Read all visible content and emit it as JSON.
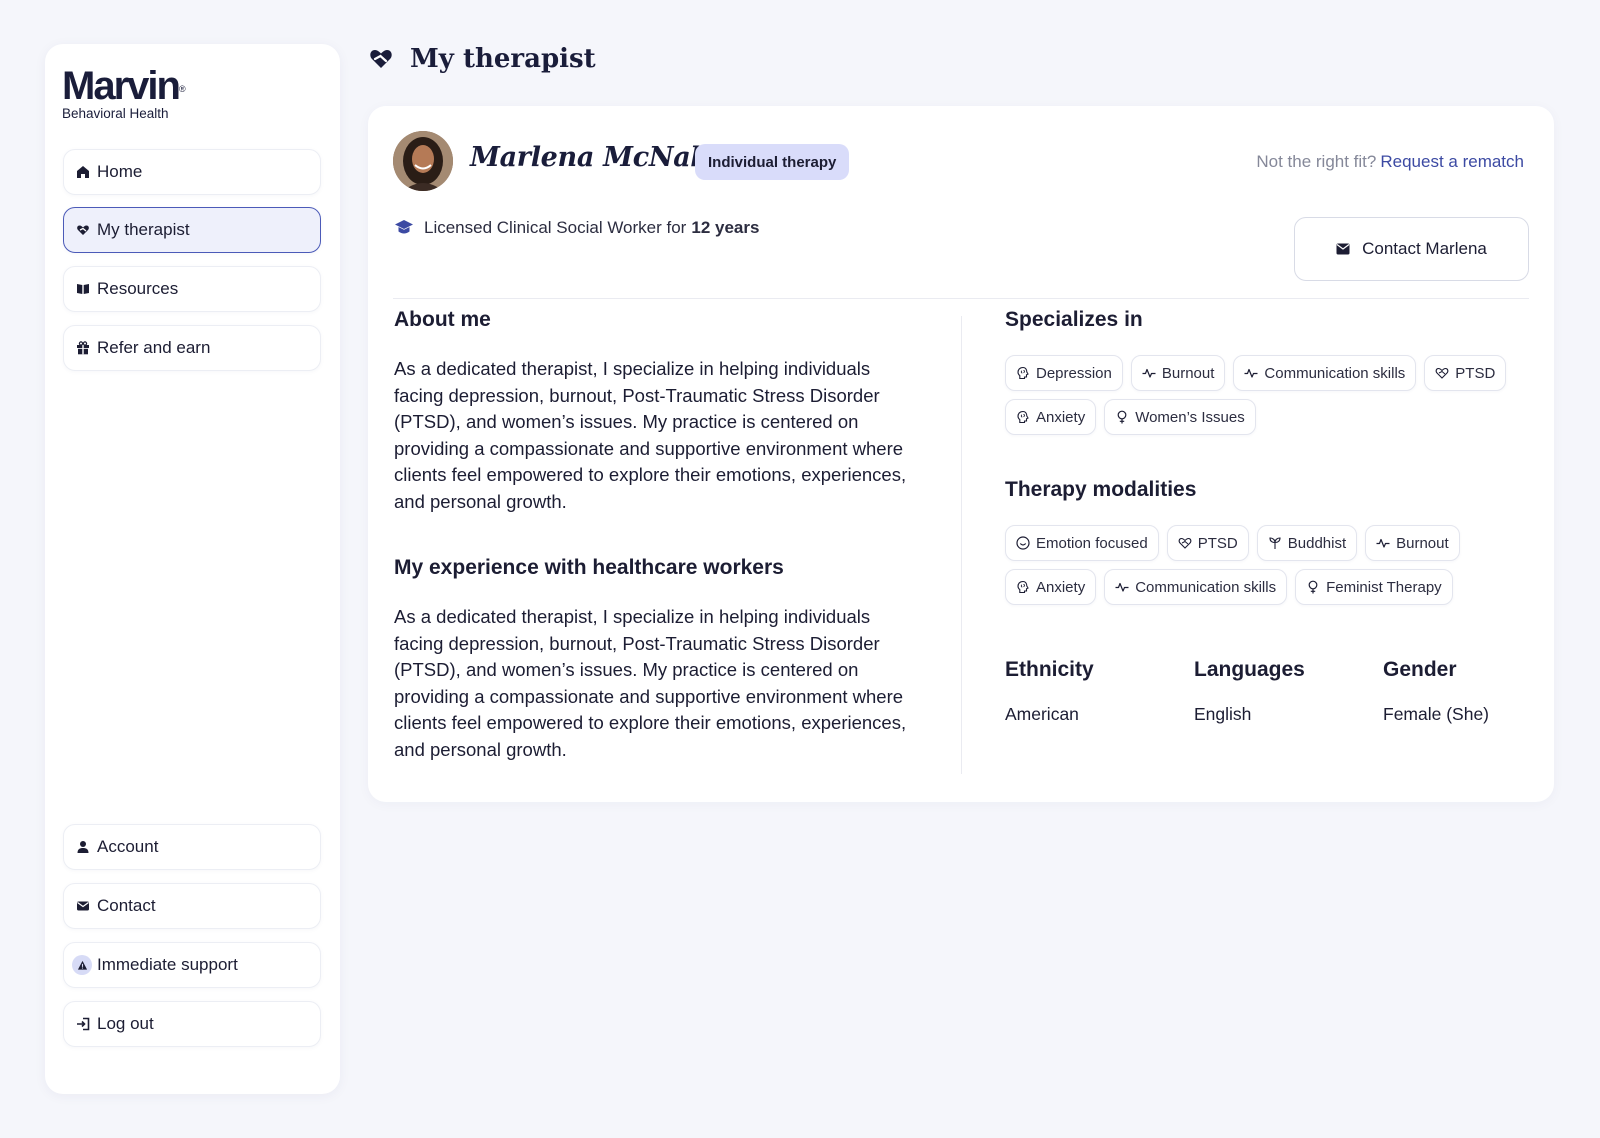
{
  "brand": {
    "name": "Marvin",
    "registered": "®",
    "subtitle": "Behavioral Health"
  },
  "nav": {
    "home": "Home",
    "my_therapist": "My therapist",
    "resources": "Resources",
    "refer": "Refer and earn",
    "account": "Account",
    "contact": "Contact",
    "support": "Immediate support",
    "logout": "Log out"
  },
  "page": {
    "title": "My therapist"
  },
  "therapist": {
    "name": "Marlena McNab",
    "badge": "Individual therapy",
    "rematch_prompt": "Not the right fit?",
    "rematch_link": "Request a rematch",
    "license_text": "Licensed Clinical Social Worker for",
    "license_years": "12 years",
    "contact_button": "Contact Marlena"
  },
  "about": {
    "heading": "About me",
    "text": "As a dedicated therapist, I specialize in helping individuals facing depression, burnout, Post-Traumatic Stress Disorder (PTSD), and women’s issues. My practice is centered on providing a compassionate and supportive environment where clients feel empowered to explore their emotions, experiences, and personal growth."
  },
  "experience": {
    "heading": "My experience with healthcare workers",
    "text": "As a dedicated therapist, I specialize in helping individuals facing depression, burnout, Post-Traumatic Stress Disorder (PTSD), and women’s issues. My practice is centered on providing a compassionate and supportive environment where clients feel empowered to explore their emotions, experiences, and personal growth."
  },
  "specializes": {
    "heading": "Specializes in",
    "chips": [
      {
        "label": "Depression",
        "icon": "brain-icon"
      },
      {
        "label": "Burnout",
        "icon": "pulse-icon"
      },
      {
        "label": "Communication skills",
        "icon": "pulse-icon"
      },
      {
        "label": "PTSD",
        "icon": "heart-hands-icon"
      },
      {
        "label": "Anxiety",
        "icon": "brain-icon"
      },
      {
        "label": "Women’s Issues",
        "icon": "female-icon"
      }
    ]
  },
  "modalities": {
    "heading": "Therapy modalities",
    "chips": [
      {
        "label": "Emotion focused",
        "icon": "smile-icon"
      },
      {
        "label": "PTSD",
        "icon": "heart-hands-icon"
      },
      {
        "label": "Buddhist",
        "icon": "lotus-icon"
      },
      {
        "label": "Burnout",
        "icon": "pulse-icon"
      },
      {
        "label": "Anxiety",
        "icon": "brain-icon"
      },
      {
        "label": "Communication skills",
        "icon": "pulse-icon"
      },
      {
        "label": "Feminist Therapy",
        "icon": "female-icon"
      }
    ]
  },
  "info": {
    "ethnicity_label": "Ethnicity",
    "ethnicity": "American",
    "languages_label": "Languages",
    "languages": "English",
    "gender_label": "Gender",
    "gender": "Female (She)"
  },
  "colors": {
    "accent": "#3c4aa3",
    "badge_bg": "#d9dcfa",
    "page_bg": "#f5f6fb",
    "active_nav_bg": "#eef0fb"
  }
}
